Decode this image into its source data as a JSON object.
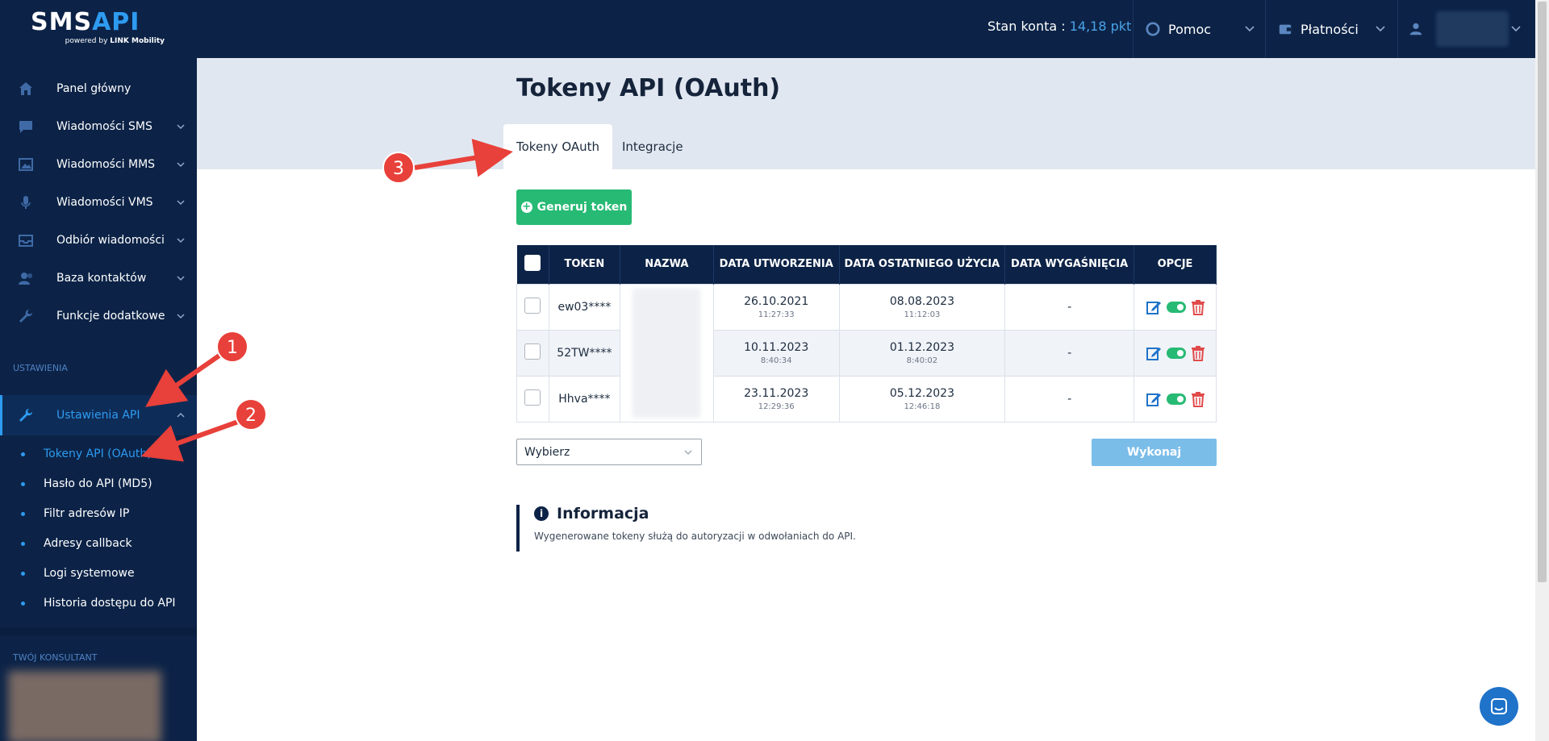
{
  "app": {
    "logo_main": "SMS",
    "logo_accent": "API",
    "logo_sub_prefix": "powered by ",
    "logo_sub_brand": "LINK Mobility"
  },
  "topbar": {
    "balance_label": "Stan konta : ",
    "balance_value": "14,18 pkt",
    "help": "Pomoc",
    "payments": "Płatności"
  },
  "sidebar": {
    "items": [
      {
        "label": "Panel główny"
      },
      {
        "label": "Wiadomości SMS"
      },
      {
        "label": "Wiadomości MMS"
      },
      {
        "label": "Wiadomości VMS"
      },
      {
        "label": "Odbiór wiadomości"
      },
      {
        "label": "Baza kontaktów"
      },
      {
        "label": "Funkcje dodatkowe"
      }
    ],
    "section_settings": "USTAWIENIA",
    "api_settings": "Ustawienia API",
    "sub_items": [
      {
        "label": "Tokeny API (OAuth)"
      },
      {
        "label": "Hasło do API (MD5)"
      },
      {
        "label": "Filtr adresów IP"
      },
      {
        "label": "Adresy callback"
      },
      {
        "label": "Logi systemowe"
      },
      {
        "label": "Historia dostępu do API"
      }
    ],
    "consultant_label": "TWÓJ KONSULTANT"
  },
  "main": {
    "title": "Tokeny API (OAuth)",
    "tabs": [
      {
        "label": "Tokeny OAuth"
      },
      {
        "label": "Integracje"
      }
    ],
    "generate_button": "Generuj token",
    "table": {
      "columns": [
        "TOKEN",
        "NAZWA",
        "DATA UTWORZENIA",
        "DATA OSTATNIEGO UŻYCIA",
        "DATA WYGAŚNIĘCIA",
        "OPCJE"
      ],
      "rows": [
        {
          "token": "ew03****",
          "created_date": "26.10.2021",
          "created_time": "11:27:33",
          "last_used_date": "08.08.2023",
          "last_used_time": "11:12:03",
          "expires": "-"
        },
        {
          "token": "52TW****",
          "created_date": "10.11.2023",
          "created_time": "8:40:34",
          "last_used_date": "01.12.2023",
          "last_used_time": "8:40:02",
          "expires": "-"
        },
        {
          "token": "Hhva****",
          "created_date": "23.11.2023",
          "created_time": "12:29:36",
          "last_used_date": "05.12.2023",
          "last_used_time": "12:46:18",
          "expires": "-"
        }
      ]
    },
    "bulk_select_value": "Wybierz",
    "execute_button": "Wykonaj",
    "info_title": "Informacja",
    "info_text": "Wygenerowane tokeny służą do autoryzacji w odwołaniach do API."
  },
  "annotations": {
    "labels": [
      "1",
      "2",
      "3"
    ]
  },
  "colors": {
    "navy": "#0c2347",
    "accent_blue": "#2d9bf0",
    "green": "#27ba74",
    "red_annotation": "#e8403a"
  }
}
